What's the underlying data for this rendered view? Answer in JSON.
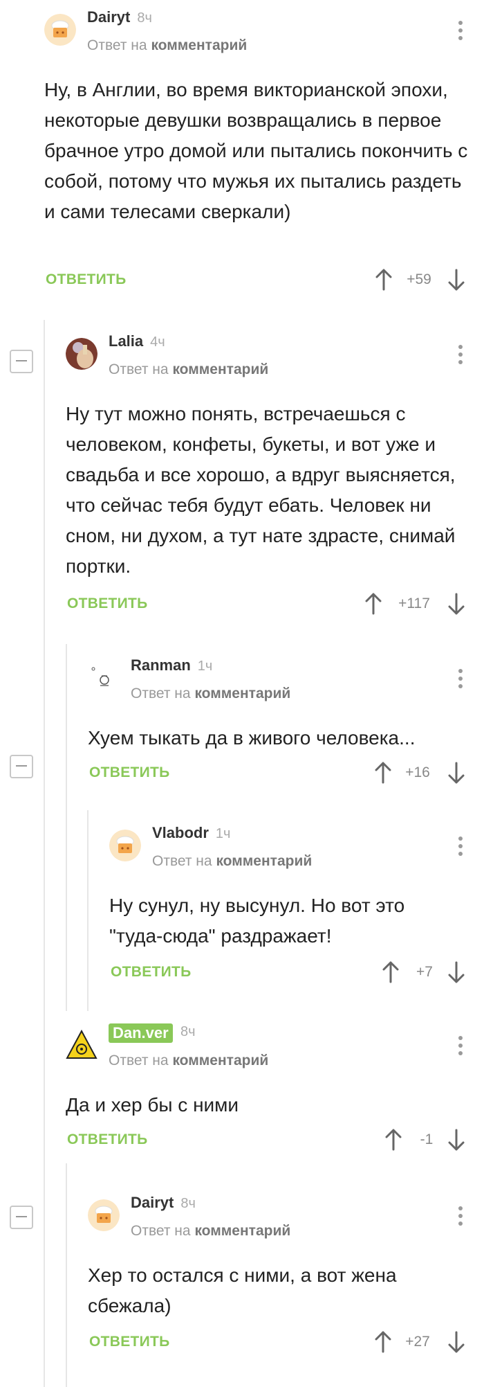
{
  "comments": [
    {
      "user": "Dairyt",
      "time": "8ч",
      "reply_prefix": "Ответ на",
      "reply_link": "комментарий",
      "text": "Ну, в Англии, во время викторианской эпохи, некоторые девушки возвращались в первое брачное утро домой или пытались покончить с собой, потому что мужья их пытались раздеть и сами телесами сверкали)",
      "reply_label": "ОТВЕТИТЬ",
      "score": "+59",
      "avatar": "chef-hat-avatar"
    },
    {
      "user": "Lalia",
      "time": "4ч",
      "reply_prefix": "Ответ на",
      "reply_link": "комментарий",
      "text": "Ну тут можно понять, встречаешься с человеком, конфеты, букеты, и вот уже и свадьба и все хорошо, а вдруг выясняется, что сейчас тебя будут ебать. Человек ни сном, ни духом, а тут нате здрасте, снимай портки.",
      "reply_label": "ОТВЕТИТЬ",
      "score": "+117",
      "avatar": "photo-avatar"
    },
    {
      "user": "Ranman",
      "time": "1ч",
      "reply_prefix": "Ответ на",
      "reply_link": "комментарий",
      "text": "Хуем тыкать да в живого человека...",
      "reply_label": "ОТВЕТИТЬ",
      "score": "+16",
      "avatar": "sketch-avatar"
    },
    {
      "user": "Vlabodr",
      "time": "1ч",
      "reply_prefix": "Ответ на",
      "reply_link": "комментарий",
      "text": "Ну сунул, ну высунул. Но вот это \"туда-сюда\" раздражает!",
      "reply_label": "ОТВЕТИТЬ",
      "score": "+7",
      "avatar": "chef-hat-avatar"
    },
    {
      "user": "Dan.ver",
      "time": "8ч",
      "reply_prefix": "Ответ на",
      "reply_link": "комментарий",
      "text": "Да и хер бы с ними",
      "reply_label": "ОТВЕТИТЬ",
      "score": "-1",
      "avatar": "biohazard-avatar"
    },
    {
      "user": "Dairyt",
      "time": "8ч",
      "reply_prefix": "Ответ на",
      "reply_link": "комментарий",
      "text": "Хер то остался с ними, а вот жена сбежала)",
      "reply_label": "ОТВЕТИТЬ",
      "score": "+27",
      "avatar": "chef-hat-avatar"
    }
  ],
  "colors": {
    "accent": "#8ac858",
    "muted": "#999999",
    "text": "#222222"
  }
}
